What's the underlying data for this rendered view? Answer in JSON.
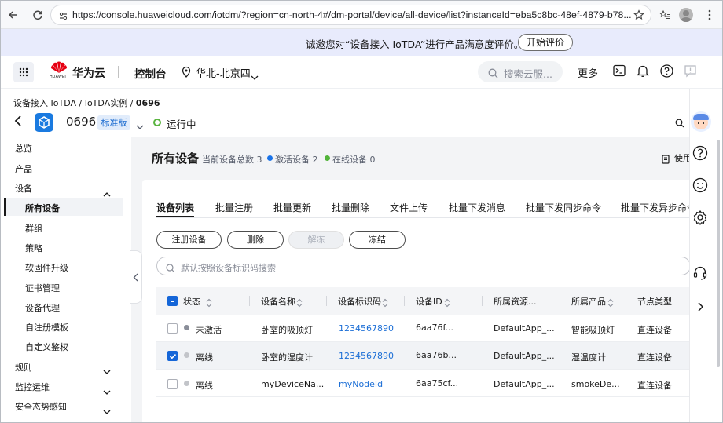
{
  "browser": {
    "url": "https://console.huaweicloud.com/iotdm/?region=cn-north-4#/dm-portal/device/all-device/list?instanceId=eba5c8bc-48ef-4879-b78..."
  },
  "banner": {
    "text": "诚邀您对“设备接入 IoTDA”进行产品满意度评价。",
    "button": "开始评价"
  },
  "topnav": {
    "brand": "华为云",
    "brand_sub": "HUAWEI",
    "console": "控制台",
    "region": "华北-北京四",
    "search_placeholder": "搜索云服...",
    "more": "更多"
  },
  "breadcrumb": {
    "items": [
      "设备接入 IoTDA",
      "IoTDA实例",
      "0696"
    ],
    "sep": " / "
  },
  "instance": {
    "name": "0696",
    "edition": "标准版",
    "status": "运行中"
  },
  "sidebar": {
    "items": [
      {
        "label": "总览"
      },
      {
        "label": "产品"
      },
      {
        "label": "设备"
      },
      {
        "label": "所有设备"
      },
      {
        "label": "群组"
      },
      {
        "label": "策略"
      },
      {
        "label": "软固件升级"
      },
      {
        "label": "证书管理"
      },
      {
        "label": "设备代理"
      },
      {
        "label": "自注册模板"
      },
      {
        "label": "自定义鉴权"
      },
      {
        "label": "规则"
      },
      {
        "label": "监控运维"
      },
      {
        "label": "安全态势感知"
      }
    ]
  },
  "main": {
    "title": "所有设备",
    "stat_total": "当前设备总数 3",
    "stat_active": "激活设备 2",
    "stat_online": "在线设备 0",
    "usage": "使用",
    "tabs": [
      "设备列表",
      "批量注册",
      "批量更新",
      "批量删除",
      "文件上传",
      "批量下发消息",
      "批量下发同步命令",
      "批量下发异步命令"
    ],
    "buttons": {
      "register": "注册设备",
      "delete": "删除",
      "unfreeze": "解冻",
      "freeze": "冻结"
    },
    "search_placeholder": "默认按照设备标识码搜索",
    "table": {
      "headers": [
        "状态",
        "设备名称",
        "设备标识码",
        "设备ID",
        "所属资源...",
        "所属产品",
        "节点类型"
      ],
      "rows": [
        {
          "checked": false,
          "status": "未激活",
          "status_color": "#8a8e99",
          "name": "卧室的吸顶灯",
          "node_id": "1234567890",
          "device_id": "6aa76f...",
          "resource": "DefaultApp_...",
          "product": "智能吸顶灯",
          "node_type": "直连设备"
        },
        {
          "checked": true,
          "status": "离线",
          "status_color": "#c2c4c9",
          "name": "卧室的湿度计",
          "node_id": "1234567890",
          "device_id": "6aa76b...",
          "resource": "DefaultApp_...",
          "product": "湿温度计",
          "node_type": "直连设备"
        },
        {
          "checked": false,
          "status": "离线",
          "status_color": "#c2c4c9",
          "name": "myDeviceNa...",
          "node_id": "myNodeId",
          "device_id": "6aa75cf...",
          "resource": "DefaultApp_...",
          "product": "smokeDe...",
          "node_type": "直连设备"
        }
      ]
    }
  },
  "colors": {
    "accent": "#1566d8",
    "link": "#1d6fd6",
    "status_active": "#1a73e8",
    "status_online": "#52b43a",
    "running": "#5ab440"
  }
}
